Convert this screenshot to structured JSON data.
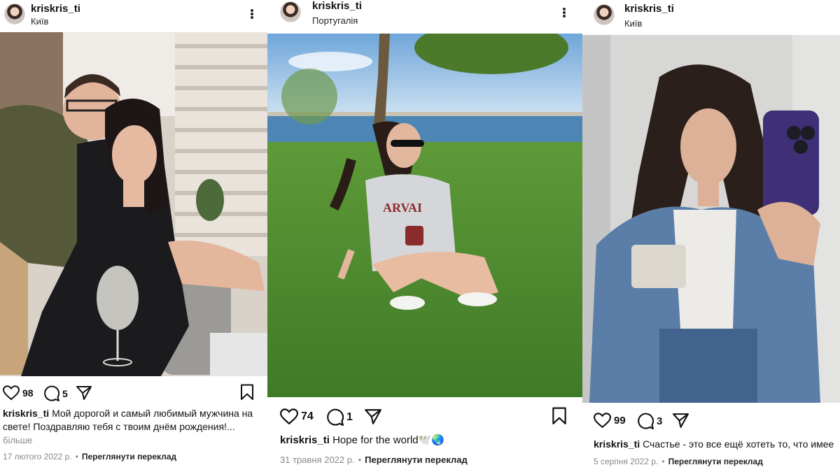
{
  "posts": [
    {
      "username": "kriskris_ti",
      "location": "Київ",
      "likes": "98",
      "comments": "5",
      "caption_user": "kriskris_ti",
      "caption_line1": "Мой дорогой и самый любимый мужчина на",
      "caption_line2": "свете! Поздравляю тебя с твоим днём рождения!...",
      "more": "більше",
      "date": "17 лютого 2022 р.",
      "separator": "•",
      "translate": "Переглянути переклад"
    },
    {
      "username": "kriskris_ti",
      "location": "Португалія",
      "likes": "74",
      "comments": "1",
      "caption_user": "kriskris_ti",
      "caption_text": "Hope for the world🕊️🌏",
      "date": "31 травня 2022 р.",
      "separator": "•",
      "translate": "Переглянути переклад"
    },
    {
      "username": "kriskris_ti",
      "location": "Київ",
      "likes": "99",
      "comments": "3",
      "caption_user": "kriskris_ti",
      "caption_text": "Счастье - это все ещё хотеть то, что имее",
      "date": "5 серпня 2022 р.",
      "separator": "•",
      "translate": "Переглянути переклад"
    }
  ],
  "icons": {
    "like": "heart-icon",
    "comment": "comment-bubble-icon",
    "share": "paper-plane-icon",
    "save": "bookmark-icon",
    "menu": "more-options-icon"
  }
}
